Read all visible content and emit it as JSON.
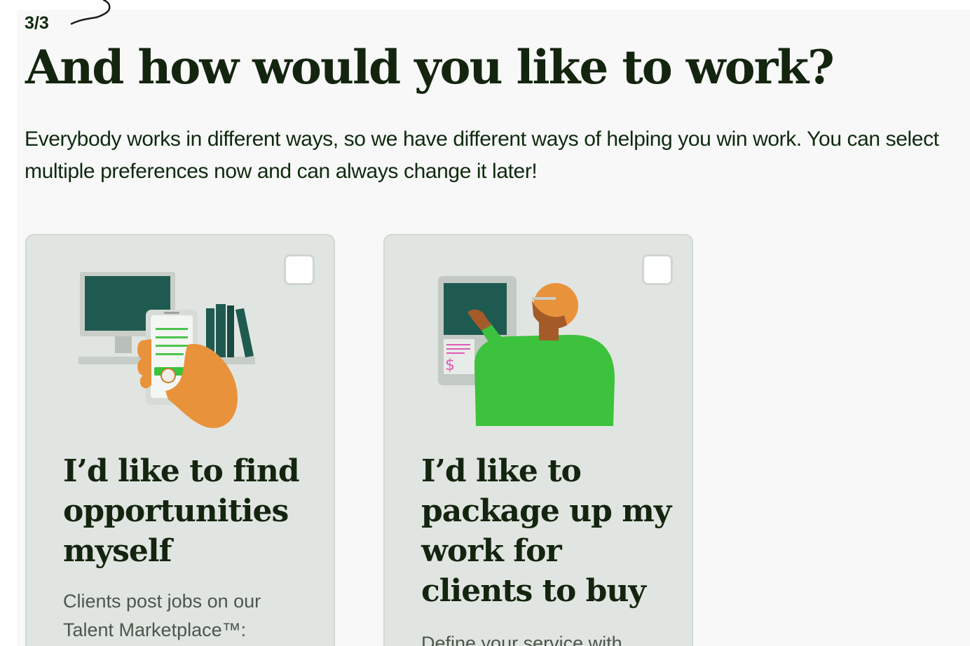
{
  "page": {
    "step": "3/3",
    "title": "And how would you like to work?",
    "subtitle": "Everybody works in different ways, so we have different ways of helping you win work. You can select multiple preferences now and can always change it later!"
  },
  "cards": [
    {
      "title": "I’d like to find opportunities myself",
      "description": "Clients post jobs on our Talent Marketplace™:",
      "checked": false,
      "illustration": "hand-holding-phone-desk-illustration"
    },
    {
      "title": "I’d like to package up my work for clients to buy",
      "description": "Define your service with",
      "checked": false,
      "illustration": "person-at-kiosk-illustration"
    }
  ],
  "colors": {
    "heading": "#14250f",
    "card_bg": "#e1e5e1",
    "panel_bg": "#f8f8f8",
    "accent_green": "#3cc23c",
    "screen_teal": "#1f5a50"
  }
}
